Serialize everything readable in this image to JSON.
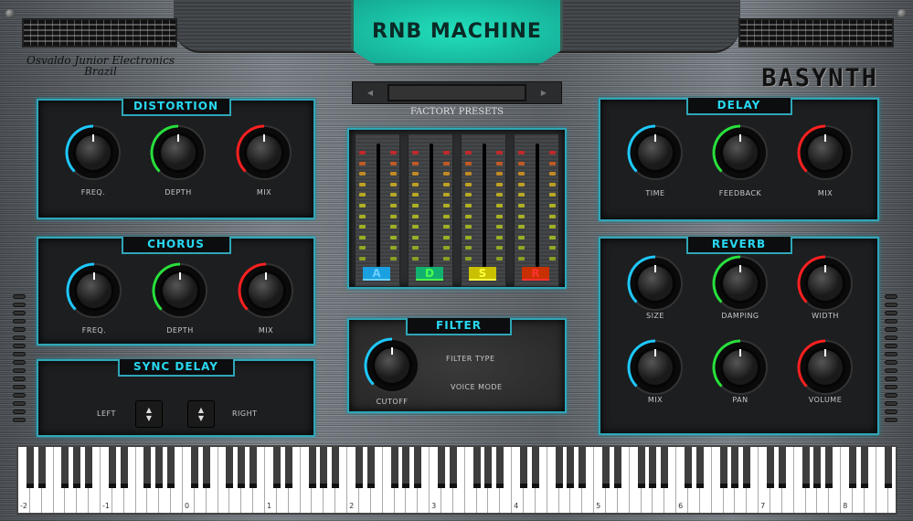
{
  "header": {
    "title": "RNB MACHINE",
    "brand_line1": "Osvaldo Junior Electronics",
    "brand_line2": "Brazil",
    "logo": "BASYNTH"
  },
  "presets": {
    "label": "FACTORY PRESETS",
    "prev_icon": "◀",
    "next_icon": "▶",
    "value": ""
  },
  "distortion": {
    "title": "DISTORTION",
    "knobs": [
      {
        "label": "FREQ.",
        "value": 0.5,
        "color": "#1ec8ff"
      },
      {
        "label": "DEPTH",
        "value": 0.5,
        "color": "#28e03c"
      },
      {
        "label": "MIX",
        "value": 0.5,
        "color": "#ff2020"
      }
    ]
  },
  "chorus": {
    "title": "CHORUS",
    "knobs": [
      {
        "label": "FREQ.",
        "value": 0.5,
        "color": "#1ec8ff"
      },
      {
        "label": "DEPTH",
        "value": 0.5,
        "color": "#28e03c"
      },
      {
        "label": "MIX",
        "value": 0.5,
        "color": "#ff2020"
      }
    ]
  },
  "sync_delay": {
    "title": "SYNC DELAY",
    "left_label": "LEFT",
    "right_label": "RIGHT",
    "up_icon": "▲",
    "down_icon": "▼"
  },
  "adsr": {
    "sliders": [
      {
        "label": "A",
        "color": "#1aa0e0",
        "text": "#6ad0ff"
      },
      {
        "label": "D",
        "color": "#12b070",
        "text": "#4aff4a"
      },
      {
        "label": "S",
        "color": "#c8c000",
        "text": "#ffff40"
      },
      {
        "label": "R",
        "color": "#c83000",
        "text": "#ff3030"
      }
    ]
  },
  "filter": {
    "title": "FILTER",
    "cutoff": {
      "label": "CUTOFF",
      "value": 0.5,
      "color": "#1ec8ff"
    },
    "filter_type_label": "FILTER TYPE",
    "voice_mode_label": "VOICE MODE"
  },
  "delay": {
    "title": "DELAY",
    "knobs": [
      {
        "label": "TIME",
        "value": 0.5,
        "color": "#1ec8ff"
      },
      {
        "label": "FEEDBACK",
        "value": 0.5,
        "color": "#28e03c"
      },
      {
        "label": "MIX",
        "value": 0.5,
        "color": "#ff2020"
      }
    ]
  },
  "reverb": {
    "title": "REVERB",
    "knobs": [
      {
        "label": "SIZE",
        "value": 0.5,
        "color": "#1ec8ff"
      },
      {
        "label": "DAMPING",
        "value": 0.5,
        "color": "#28e03c"
      },
      {
        "label": "WIDTH",
        "value": 0.5,
        "color": "#ff2020"
      },
      {
        "label": "MIX",
        "value": 0.5,
        "color": "#1ec8ff"
      },
      {
        "label": "PAN",
        "value": 0.5,
        "color": "#28e03c"
      },
      {
        "label": "VOLUME",
        "value": 0.5,
        "color": "#ff2020"
      }
    ]
  },
  "keyboard": {
    "octave_labels": [
      "-2",
      "-1",
      "0",
      "1",
      "2",
      "3",
      "4",
      "5",
      "6",
      "7",
      "8"
    ]
  }
}
